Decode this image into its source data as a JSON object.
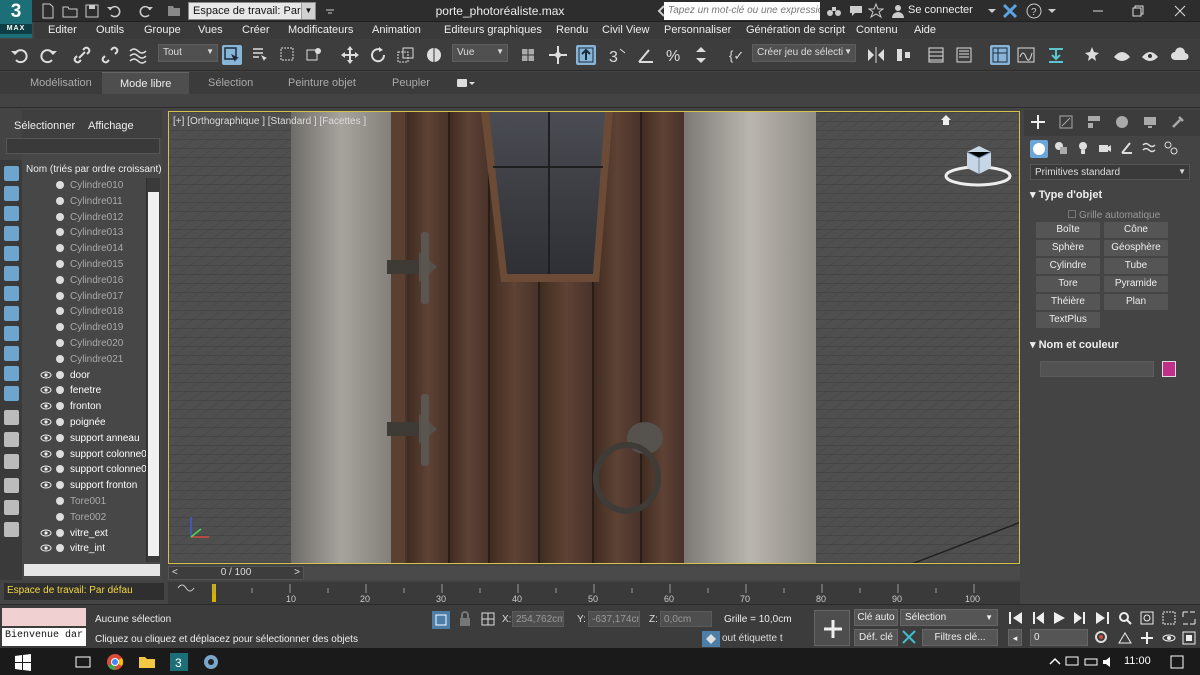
{
  "app": {
    "logo_number": "3",
    "logo_sub": "MAX",
    "doc_title": "porte_photoréaliste.max"
  },
  "titlebar": {
    "workspace": "Espace de travail: Par",
    "search_placeholder": "Tapez un mot-clé ou une expression",
    "login": "Se connecter"
  },
  "menu": [
    "Editer",
    "Outils",
    "Groupe",
    "Vues",
    "Créer",
    "Modificateurs",
    "Animation",
    "Editeurs graphiques",
    "Rendu",
    "Civil View",
    "Personnaliser",
    "Génération de script",
    "Contenu",
    "Aide"
  ],
  "toolbar": {
    "filter": "Tout",
    "ref_coord": "Vue",
    "selection_set": "Créer jeu de sélecti"
  },
  "ribbon": {
    "tabs": [
      "Modélisation",
      "Mode libre",
      "Sélection",
      "Peinture objet",
      "Peupler"
    ]
  },
  "explorer": {
    "tab_select": "Sélectionner",
    "tab_display": "Affichage",
    "sort_label": "Nom (triés par ordre croissant)",
    "objects": [
      {
        "name": "Cylindre010",
        "visible": false
      },
      {
        "name": "Cylindre011",
        "visible": false
      },
      {
        "name": "Cylindre012",
        "visible": false
      },
      {
        "name": "Cylindre013",
        "visible": false
      },
      {
        "name": "Cylindre014",
        "visible": false
      },
      {
        "name": "Cylindre015",
        "visible": false
      },
      {
        "name": "Cylindre016",
        "visible": false
      },
      {
        "name": "Cylindre017",
        "visible": false
      },
      {
        "name": "Cylindre018",
        "visible": false
      },
      {
        "name": "Cylindre019",
        "visible": false
      },
      {
        "name": "Cylindre020",
        "visible": false
      },
      {
        "name": "Cylindre021",
        "visible": false
      },
      {
        "name": "door",
        "visible": true
      },
      {
        "name": "fenetre",
        "visible": true
      },
      {
        "name": "fronton",
        "visible": true
      },
      {
        "name": "poignée",
        "visible": true
      },
      {
        "name": "support anneau",
        "visible": true
      },
      {
        "name": "support colonne00",
        "visible": true
      },
      {
        "name": "support colonne00",
        "visible": true
      },
      {
        "name": "support fronton",
        "visible": true
      },
      {
        "name": "Tore001",
        "visible": false
      },
      {
        "name": "Tore002",
        "visible": false
      },
      {
        "name": "vitre_ext",
        "visible": true
      },
      {
        "name": "vitre_int",
        "visible": true
      }
    ],
    "workspace": "Espace de travail: Par défau"
  },
  "viewport": {
    "label": "[+] [Orthographique ] [Standard ] [Facettes ]"
  },
  "timeline": {
    "slider": "0 / 100",
    "ticks": [
      "10",
      "20",
      "30",
      "40",
      "50",
      "60",
      "70",
      "80",
      "90",
      "100"
    ]
  },
  "command_panel": {
    "primitive_type": "Primitives standard",
    "object_type_title": "Type d'objet",
    "autogrid": "Grille automatique",
    "buttons": [
      "Boîte",
      "Cône",
      "Sphère",
      "Géosphère",
      "Cylindre",
      "Tube",
      "Tore",
      "Pyramide",
      "Théière",
      "Plan",
      "TextPlus"
    ],
    "name_color_title": "Nom et couleur",
    "object_color": "#c03088"
  },
  "status": {
    "welcome": "Bienvenue dar",
    "selection": "Aucune sélection",
    "prompt": "Cliquez ou cliquez et déplacez pour sélectionner des objets",
    "x_label": "X:",
    "x_value": "254,762cm",
    "y_label": "Y:",
    "y_value": "-637,174cm",
    "z_label": "Z:",
    "z_value": "0,0cm",
    "grid": "Grille = 10,0cm",
    "add_time_tag": "out étiquette t",
    "auto_key": "Clé auto",
    "set_key": "Déf. clé",
    "key_mode": "Sélection",
    "key_filters": "Filtres clé...",
    "frame": "0"
  },
  "taskbar": {
    "clock": "11:00"
  }
}
